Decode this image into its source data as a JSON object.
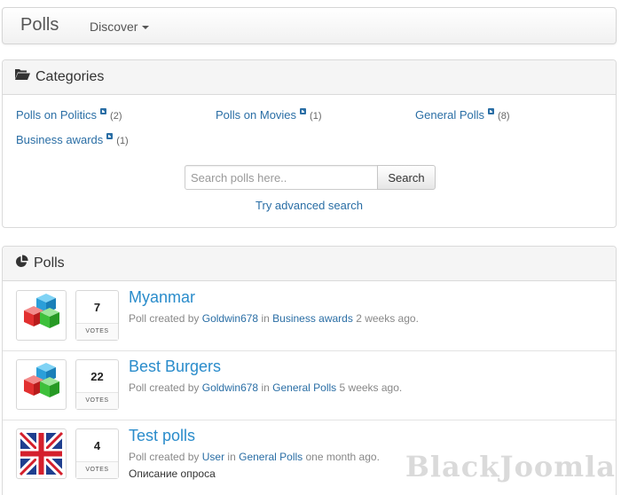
{
  "navbar": {
    "brand": "Polls",
    "discover_label": "Discover"
  },
  "categories": {
    "title": "Categories",
    "items": [
      {
        "label": "Polls on Politics",
        "count": "(2)"
      },
      {
        "label": "Polls on Movies",
        "count": "(1)"
      },
      {
        "label": "General Polls",
        "count": "(8)"
      },
      {
        "label": "Business awards",
        "count": "(1)"
      }
    ],
    "search": {
      "placeholder": "Search polls here..",
      "button_label": "Search"
    },
    "advanced_link": "Try advanced search"
  },
  "polls": {
    "title": "Polls",
    "votes_label": "VOTES",
    "items": [
      {
        "title": "Myanmar",
        "votes": "7",
        "prefix": "Poll created by",
        "author": "Goldwin678",
        "in_word": "in",
        "category": "Business awards",
        "time": "2 weeks ago.",
        "image": "cubes-icon"
      },
      {
        "title": "Best Burgers",
        "votes": "22",
        "prefix": "Poll created by",
        "author": "Goldwin678",
        "in_word": "in",
        "category": "General Polls",
        "time": "5 weeks ago.",
        "image": "cubes-icon"
      },
      {
        "title": "Test polls",
        "votes": "4",
        "prefix": "Poll created by",
        "author": "User",
        "in_word": "in",
        "category": "General Polls",
        "time": "one month ago.",
        "image": "uk-flag",
        "description": "Описание опроса"
      }
    ]
  },
  "watermark": "BlackJoomla"
}
